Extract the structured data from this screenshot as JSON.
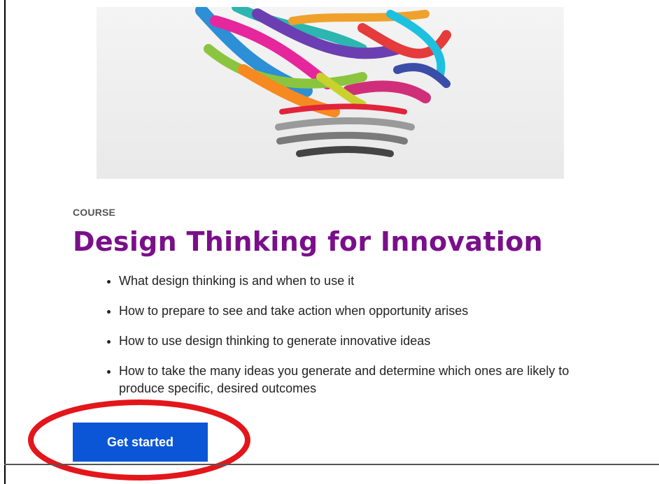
{
  "course": {
    "eyebrow": "COURSE",
    "title": "Design Thinking for Innovation",
    "bullets": [
      "What design thinking is and when to use it",
      "How to prepare to see and take action when opportunity arises",
      "How to use design thinking to generate innovative ideas",
      "How to take the many ideas you generate and determine which ones are likely to produce specific, desired outcomes"
    ],
    "cta_label": "Get started"
  },
  "colors": {
    "title": "#7a0f8a",
    "cta_background": "#0b56d6",
    "annotation": "#e3161b"
  },
  "icons": {
    "hero": "lightbulb-paint-strokes-image"
  }
}
